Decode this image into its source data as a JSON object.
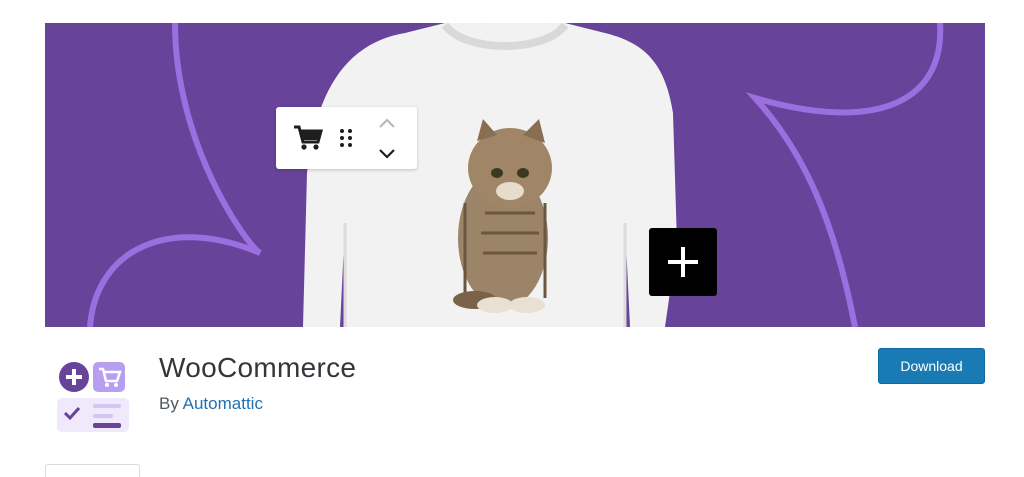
{
  "banner": {
    "alt": "WooCommerce banner: white sweatshirt with kitten print on purple background",
    "background": "#674399",
    "accent_line": "#9b6fe0",
    "toolbar_icons": [
      "cart-icon",
      "drag-handle-icon",
      "chevron-up-icon",
      "chevron-down-icon"
    ],
    "add_block_icon": "plus-icon"
  },
  "plugin": {
    "name": "WooCommerce",
    "by_label": "By",
    "author": "Automattic",
    "author_color": "#2271b1",
    "icon": "woocommerce-plugin-icon"
  },
  "actions": {
    "download_label": "Download",
    "download_color": "#1a7bb4"
  }
}
